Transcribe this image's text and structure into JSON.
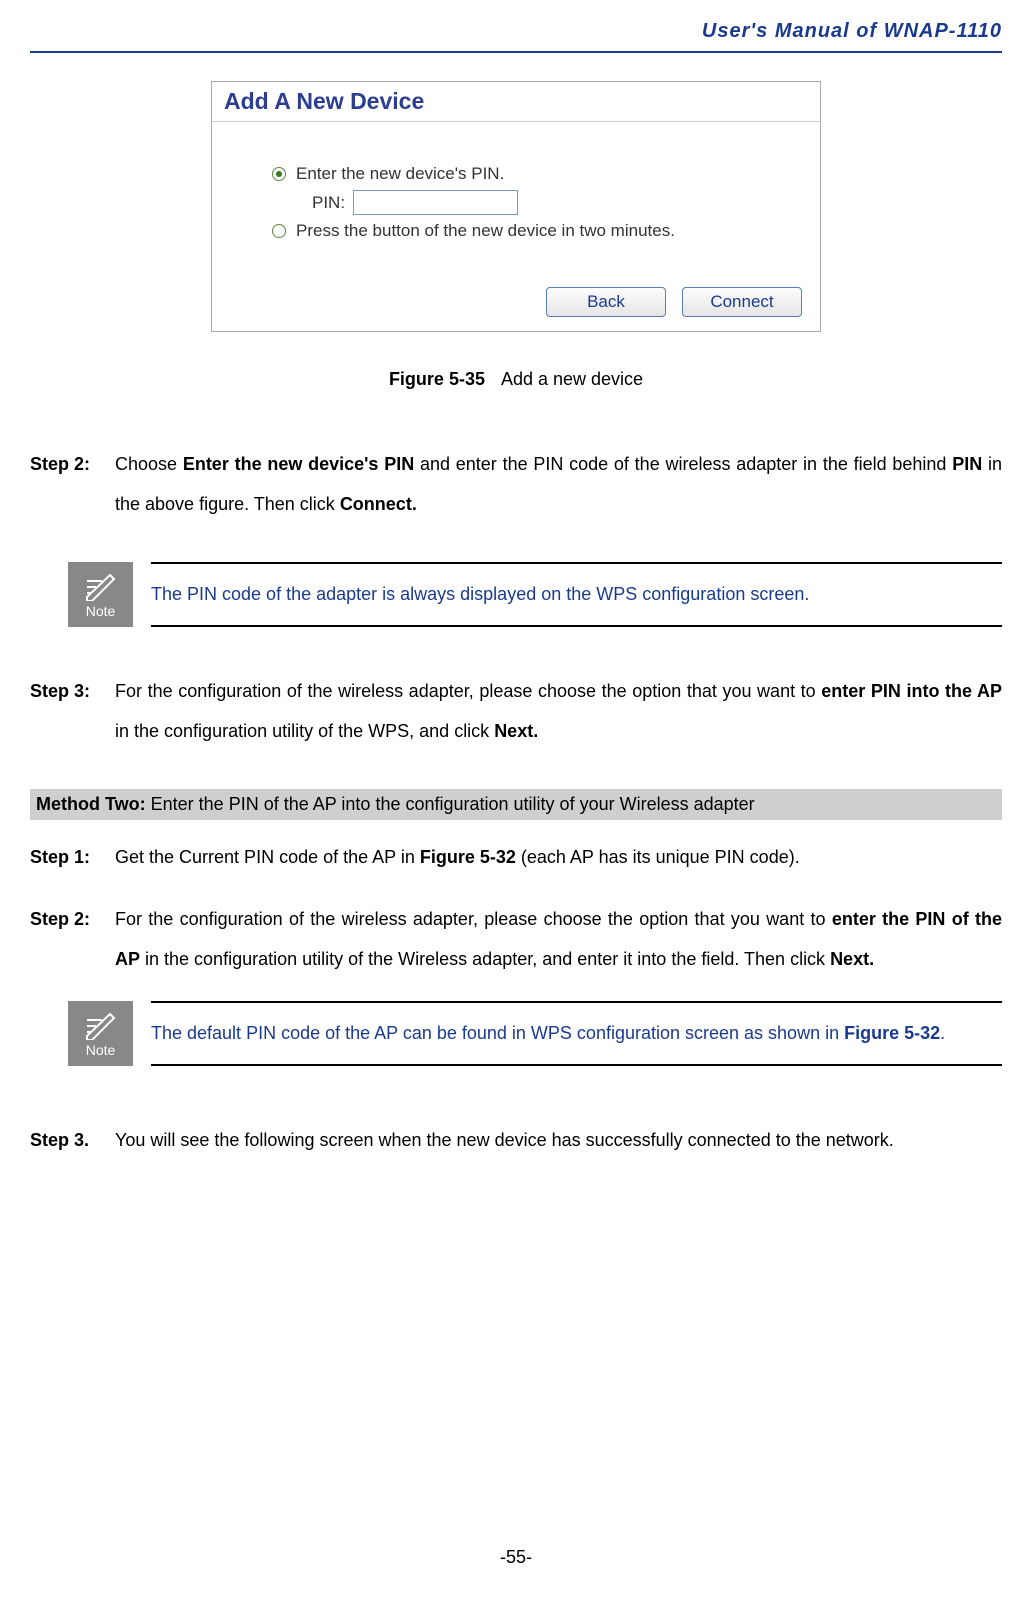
{
  "header": {
    "title": "User's  Manual  of  WNAP-1110"
  },
  "dialog": {
    "title": "Add A New Device",
    "option_pin": "Enter the new device's PIN.",
    "pin_label": "PIN:",
    "pin_value": "",
    "option_button": "Press the button of the new device in two minutes.",
    "back": "Back",
    "connect": "Connect"
  },
  "figure": {
    "number": "Figure 5-35",
    "caption": "Add a new device"
  },
  "step2": {
    "label": "Step 2:",
    "pre": "Choose ",
    "b1": "Enter the new device's PIN",
    "mid1": " and enter the PIN code of the wireless adapter in the field behind ",
    "b2": "PIN",
    "mid2": " in the above figure. Then click ",
    "b3": "Connect."
  },
  "note1": {
    "icon_label": "Note",
    "text": "The PIN code of the adapter is always displayed on the WPS configuration screen."
  },
  "step3": {
    "label": "Step 3:",
    "pre": "For the configuration of the wireless adapter, please choose the option that you want to ",
    "b1": "enter PIN into the AP",
    "mid": " in the configuration utility of the WPS, and click ",
    "b2": "Next."
  },
  "method": {
    "label": "Method Two:",
    "text": " Enter the PIN of the AP into the configuration utility of your Wireless adapter"
  },
  "m2step1": {
    "label": "Step 1:",
    "pre": "Get the Current PIN code of the AP in ",
    "b1": "Figure 5-32",
    "post": " (each AP has its unique PIN code)."
  },
  "m2step2": {
    "label": "Step 2:",
    "pre": "For the configuration of the wireless adapter, please choose the option that you want to ",
    "b1": "enter the PIN of the AP",
    "mid": " in the configuration utility of the Wireless adapter, and enter it into the field. Then click ",
    "b2": "Next."
  },
  "note2": {
    "icon_label": "Note",
    "pre": "The default PIN code of the AP can be found in WPS configuration screen as shown in ",
    "b1": "Figure 5-32",
    "post": "."
  },
  "m2step3": {
    "label": "Step 3.",
    "text": "You will see the following screen when the new device has successfully connected to the network."
  },
  "page_number": "-55-"
}
